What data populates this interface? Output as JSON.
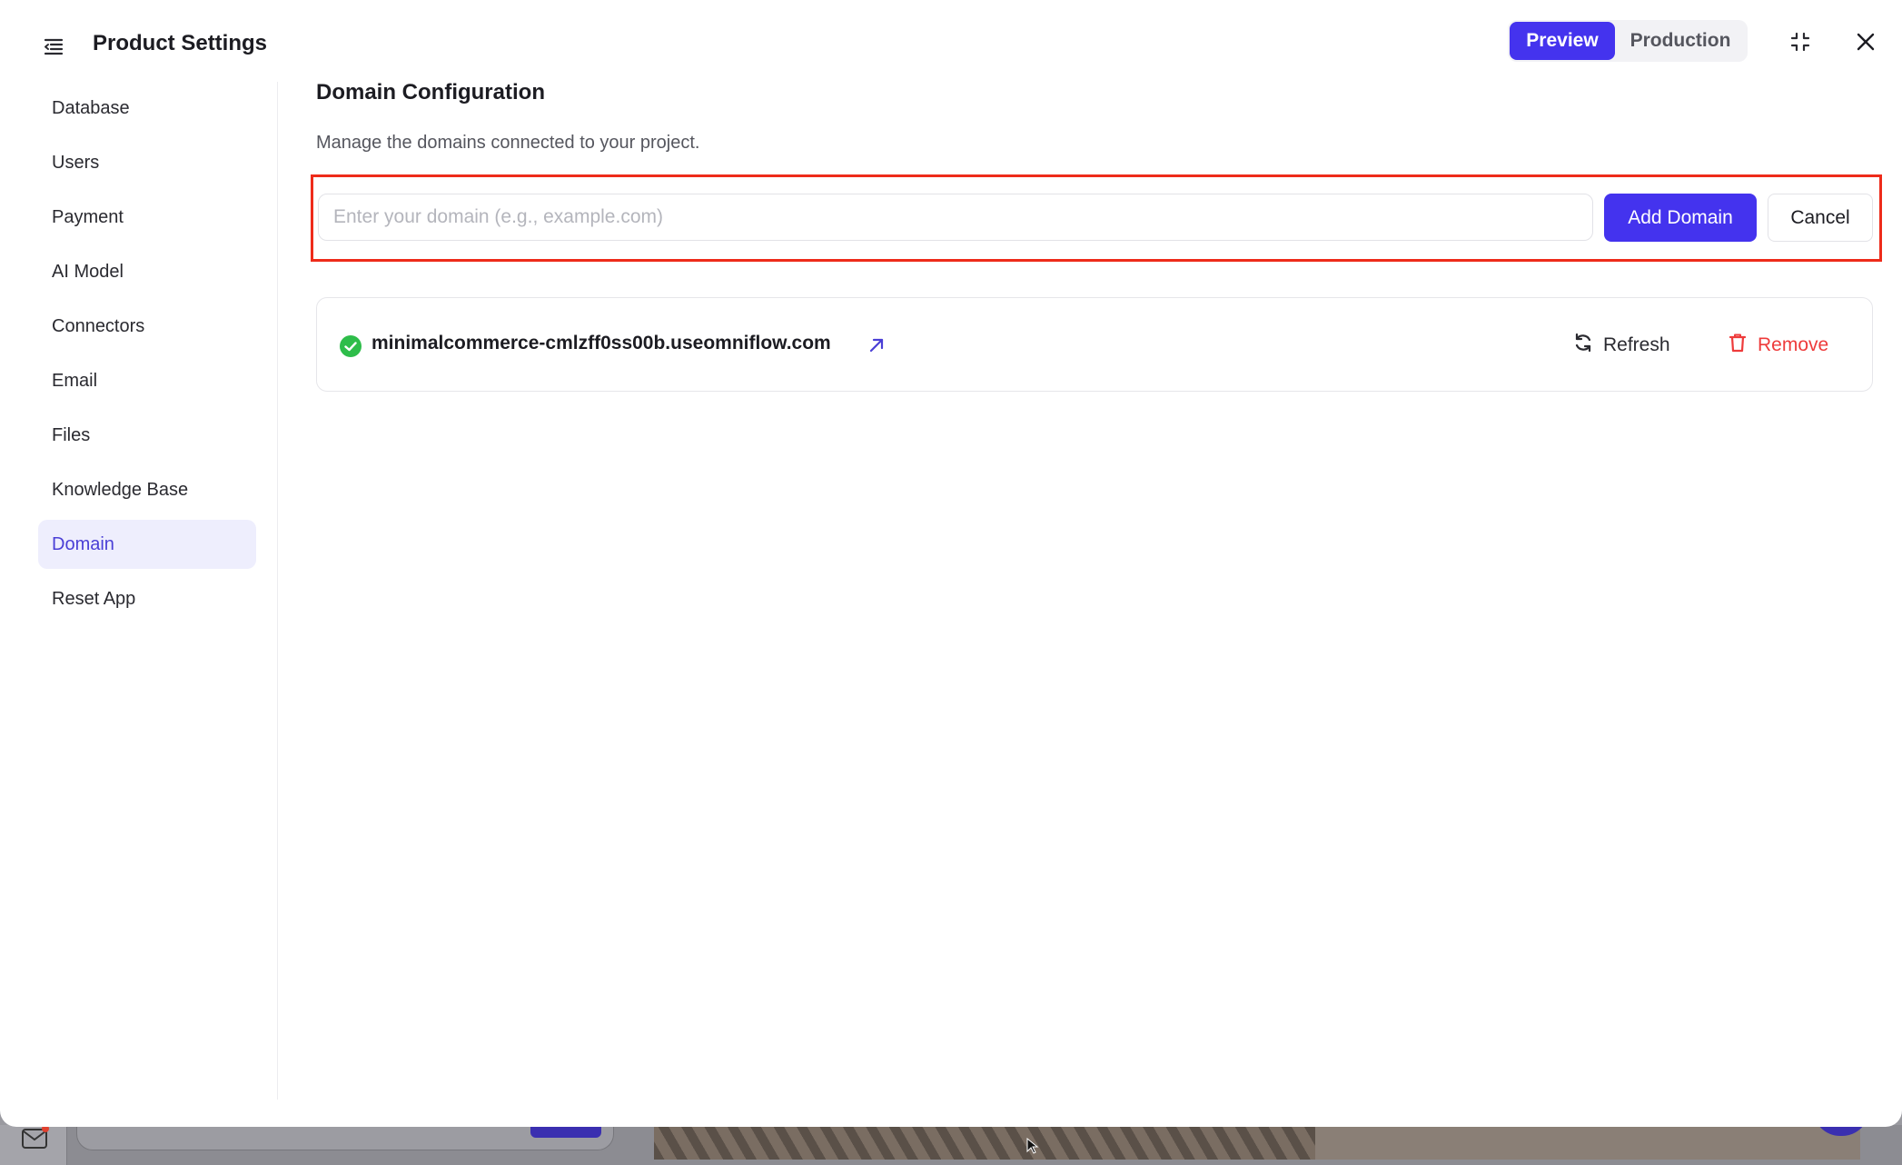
{
  "header": {
    "title": "Product Settings",
    "env_preview": "Preview",
    "env_production": "Production"
  },
  "sidebar": {
    "items": [
      {
        "label": "Database"
      },
      {
        "label": "Users"
      },
      {
        "label": "Payment"
      },
      {
        "label": "AI Model"
      },
      {
        "label": "Connectors"
      },
      {
        "label": "Email"
      },
      {
        "label": "Files"
      },
      {
        "label": "Knowledge Base"
      },
      {
        "label": "Domain",
        "active": true
      },
      {
        "label": "Reset App"
      }
    ]
  },
  "main": {
    "title": "Domain Configuration",
    "description": "Manage the domains connected to your project.",
    "input_placeholder": "Enter your domain (e.g., example.com)",
    "input_value": "",
    "add_label": "Add Domain",
    "cancel_label": "Cancel",
    "domains": [
      {
        "name": "minimalcommerce-cmlzff0ss00b.useomniflow.com",
        "refresh_label": "Refresh",
        "remove_label": "Remove"
      }
    ]
  },
  "colors": {
    "accent": "#4433ee",
    "danger": "#ee3b3b",
    "success": "#2ebd4a",
    "highlight": "#ee2b1a"
  },
  "icons": {
    "menu": "menu-collapse-icon",
    "collapse": "collapse-icon",
    "close": "close-icon",
    "check": "check-circle-icon",
    "external": "external-link-icon",
    "refresh": "refresh-icon",
    "trash": "trash-icon"
  }
}
